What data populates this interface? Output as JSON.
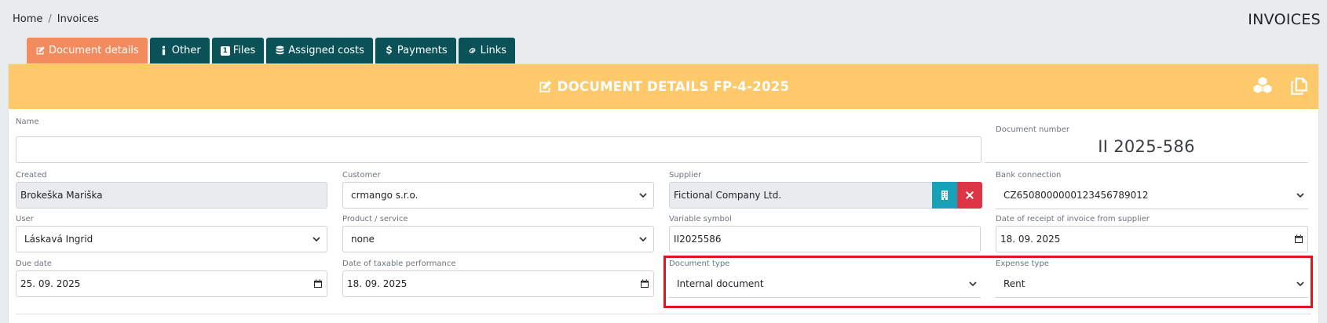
{
  "breadcrumb": {
    "home": "Home",
    "separator": "/",
    "current": "Invoices"
  },
  "page_title": "INVOICES",
  "tabs": [
    {
      "label": "Document details",
      "icon": "edit-icon",
      "active": true
    },
    {
      "label": "Other",
      "icon": "info-icon",
      "active": false
    },
    {
      "label": "Files",
      "icon": "files-count-icon",
      "active": false
    },
    {
      "label": "Assigned costs",
      "icon": "database-icon",
      "active": false
    },
    {
      "label": "Payments",
      "icon": "dollar-icon",
      "active": false
    },
    {
      "label": "Links",
      "icon": "link-icon",
      "active": false
    }
  ],
  "files_count": "1",
  "card": {
    "title": "DOCUMENT DETAILS FP-4-2025"
  },
  "form": {
    "name": {
      "label": "Name",
      "value": ""
    },
    "document_number": {
      "label": "Document number",
      "value": "II 2025-586"
    },
    "created": {
      "label": "Created",
      "value": "Brokeška Mariška"
    },
    "customer": {
      "label": "Customer",
      "value": "crmango s.r.o."
    },
    "supplier": {
      "label": "Supplier",
      "value": "Fictional Company Ltd."
    },
    "bank_connection": {
      "label": "Bank connection",
      "value": "CZ6508000000123456789012"
    },
    "user": {
      "label": "User",
      "value": "Láskavá Ingrid"
    },
    "product_service": {
      "label": "Product / service",
      "value": "none"
    },
    "variable_symbol": {
      "label": "Variable symbol",
      "value": "II2025586"
    },
    "receipt_date": {
      "label": "Date of receipt of invoice from supplier",
      "value": "18. 09. 2025"
    },
    "due_date": {
      "label": "Due date",
      "value": "25. 09. 2025"
    },
    "taxable_date": {
      "label": "Date of taxable performance",
      "value": "18. 09. 2025"
    },
    "document_type": {
      "label": "Document type",
      "value": "Internal document"
    },
    "expense_type": {
      "label": "Expense type",
      "value": "Rent"
    }
  },
  "colors": {
    "tab_bg": "#0b5258",
    "tab_active": "#f28c5e",
    "header_bg": "#fdc96a",
    "info_button": "#17a2b8",
    "danger_button": "#dc3545",
    "highlight": "#e0161b"
  }
}
